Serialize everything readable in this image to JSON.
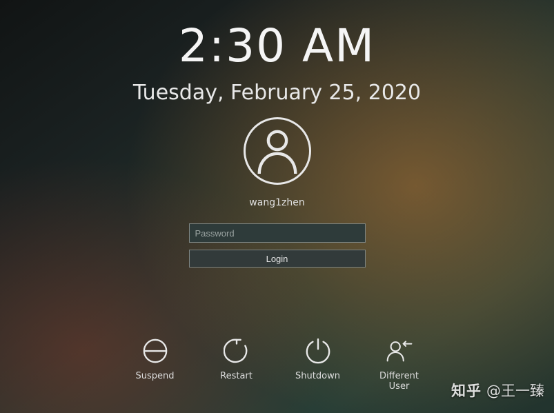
{
  "clock": {
    "time": "2:30 AM",
    "date": "Tuesday, February 25, 2020"
  },
  "user": {
    "name": "wang1zhen"
  },
  "password": {
    "placeholder": "Password",
    "value": ""
  },
  "login": {
    "label": "Login"
  },
  "actions": {
    "suspend": "Suspend",
    "restart": "Restart",
    "shutdown": "Shutdown",
    "different_user": "Different\nUser"
  },
  "watermark": {
    "brand": "知乎",
    "author": "@王一臻"
  }
}
